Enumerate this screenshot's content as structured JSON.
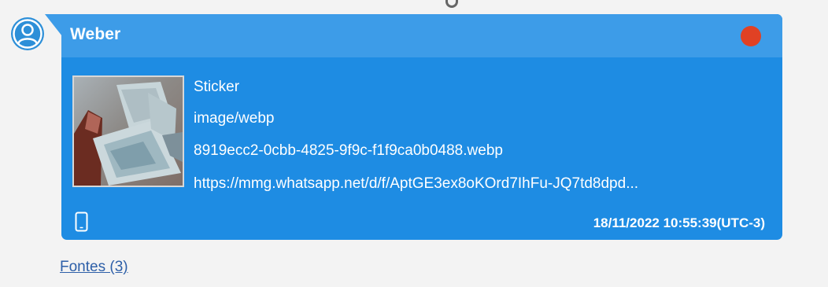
{
  "message": {
    "sender": "Weber",
    "status_color": "#e04124",
    "attachment": {
      "type_label": "Sticker",
      "mime": "image/webp",
      "filename": "8919ecc2-0cbb-4825-9f9c-f1f9ca0b0488.webp",
      "url": "https://mmg.whatsapp.net/d/f/AptGE3ex8oKOrd7IhFu-JQ7td8dpd..."
    },
    "device_icon": "phone-icon",
    "timestamp": "18/11/2022 10:55:39(UTC-3)"
  },
  "sources_link": "Fontes (3)",
  "colors": {
    "bubble": "#1e8ce3",
    "bubble_header": "#3d9ce8",
    "link": "#2d5fa8"
  }
}
